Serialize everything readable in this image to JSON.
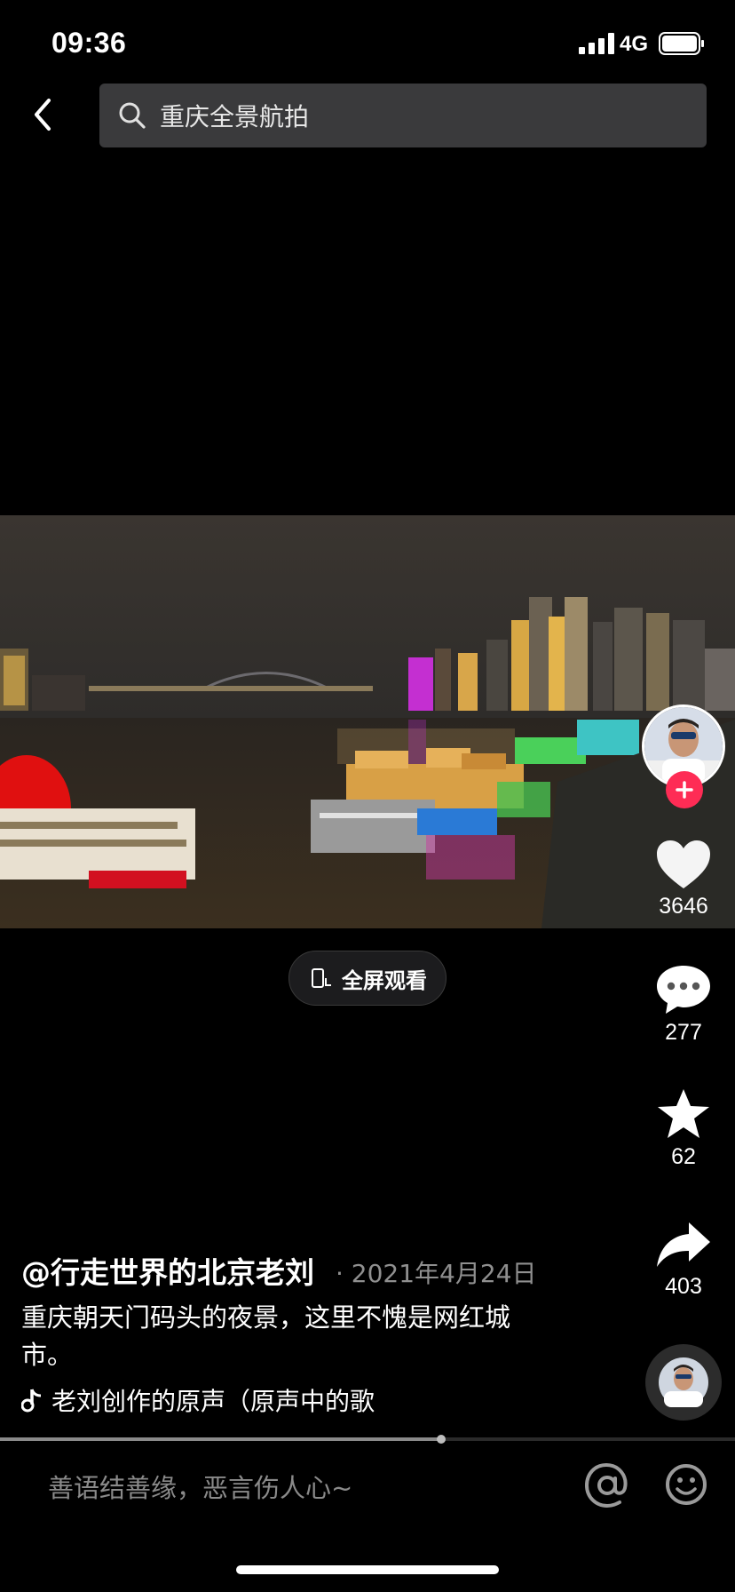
{
  "status_bar": {
    "time": "09:36",
    "network": "4G"
  },
  "search": {
    "query": "重庆全景航拍"
  },
  "player": {
    "fullscreen_label": "全屏观看",
    "progress_fraction": 0.6
  },
  "actions": {
    "likes": "3646",
    "comments": "277",
    "favorites": "62",
    "shares": "403"
  },
  "post": {
    "author": "@行走世界的北京老刘",
    "date": "· 2021年4月24日",
    "caption": "重庆朝天门码头的夜景，这里不愧是网红城市。",
    "music": "老刘创作的原声（原声中的歌"
  },
  "comment": {
    "placeholder": "善语结善缘，恶言伤人心~"
  },
  "colors": {
    "accent": "#fe2c55",
    "search_bg": "#3a3a3c",
    "background": "#000000"
  },
  "icons": [
    "back-arrow-icon",
    "search-icon",
    "fullscreen-icon",
    "plus-icon",
    "heart-icon",
    "comment-icon",
    "star-icon",
    "share-icon",
    "music-note-icon",
    "at-icon",
    "emoji-icon"
  ]
}
